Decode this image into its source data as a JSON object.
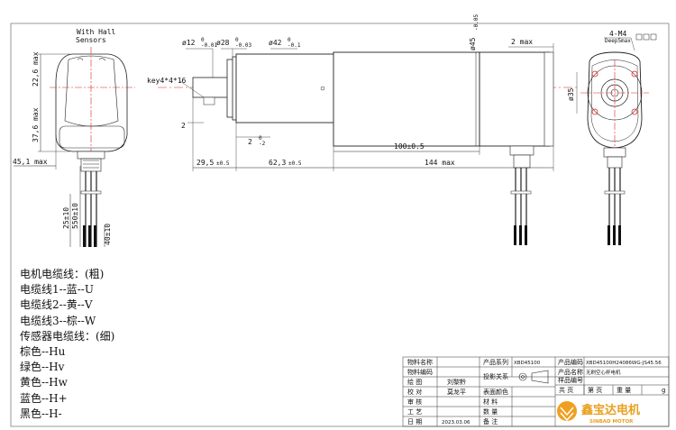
{
  "drawing": {
    "hall_sensors_label_1": "With Hall",
    "hall_sensors_label_2": "Sensors",
    "left_view": {
      "dim_22_6": "22,6 max",
      "dim_37_6": "37,6 max",
      "dim_45_1": "45,1 max",
      "dim_550": "550±10",
      "dim_25": "25±10",
      "dim_40": "40±10"
    },
    "side_view": {
      "key_label": "key4*4*16",
      "shaft_dia": "ø12",
      "shaft_tol_top": "0",
      "shaft_tol_bot": "-0.01",
      "pilot_dia": "ø28",
      "pilot_tol_top": "0",
      "pilot_tol_bot": "-0.03",
      "body_dia": "ø42",
      "body_tol_top": "0",
      "body_tol_bot": "-0.1",
      "cap_dia": "ø45",
      "cap_tol": "-0.05",
      "dim_2max": "2 max",
      "dim_2": "2",
      "dim_2_step": "2",
      "dim_2_step_tol_top": "0",
      "dim_2_step_tol_bot": "-2",
      "dim_29_5": "29,5",
      "dim_29_5_tol": "±0.5",
      "dim_62_3": "62,3",
      "dim_62_3_tol": "±0.5",
      "dim_100": "100±0.5",
      "dim_144": "144 max"
    },
    "right_view": {
      "hole_label": "4-M4",
      "hole_depth": "Deep5max",
      "dim_35": "ø35"
    }
  },
  "notes": [
    "电机电缆线：(粗)",
    "电缆线1--蓝--U",
    "电缆线2--黄--V",
    "电缆线3--棕--W",
    "传感器电缆线：(细)",
    "棕色--Hu",
    "绿色--Hv",
    "黄色--Hw",
    "蓝色--H+",
    "黑色--H-"
  ],
  "title_block": {
    "r1_c1": "物料名称",
    "r1_c3": "产品系列",
    "r1_c4": "XBD45100",
    "r1_c5": "产品编码",
    "r1_c6": "XBD45100H24086WG-JS45.56",
    "r2_c1": "物料编码",
    "r2_c3": "投影关系",
    "r2_c5": "产品名称",
    "r2_c6": "无刷空心杯电机",
    "r3_c1": "绘 图",
    "r3_c2": "刘黎黔",
    "r3_c5": "样品编号",
    "r4_c1": "校 对",
    "r4_c2": "莫龙平",
    "r4_c3": "表面颜色",
    "r4_c5": "共 页",
    "r4_c6": "第 页",
    "r4_c7": "重 量",
    "r4_c8": "g",
    "r5_c1": "审 核",
    "r5_c3": "材 料",
    "r6_c1": "工 艺",
    "r6_c3": "数 量",
    "r7_c1": "日 期",
    "r7_c2": "2023.03.06",
    "r7_c3": "备 注"
  },
  "logo": {
    "name_cn": "鑫宝达电机",
    "name_en": "SINBAD MOTOR",
    "bg_color": "#f0a020",
    "text_color": "#e8a020"
  },
  "colors": {
    "centerline": "#e02020",
    "outline": "#222222"
  }
}
